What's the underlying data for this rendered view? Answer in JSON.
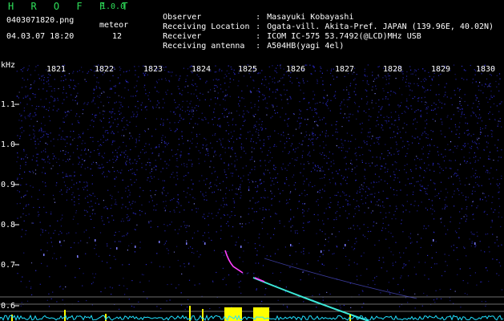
{
  "app": {
    "name": "H R O F F T",
    "version": "1.0.0",
    "filename": "0403071820.png",
    "count_label": "meteor",
    "datetime": "04.03.07 18:20",
    "count": "12"
  },
  "meta": [
    {
      "key": "Observer",
      "value": "Masayuki Kobayashi"
    },
    {
      "key": "Receiving Location",
      "value": "Ogata-vill. Akita-Pref. JAPAN (139.96E, 40.02N)"
    },
    {
      "key": "Receiver",
      "value": "ICOM IC-575 53.7492(@LCD)MHz USB"
    },
    {
      "key": "Receiving antenna",
      "value": "A504HB(yagi 4el)"
    }
  ],
  "axis": {
    "y_unit": "kHz",
    "y_ticks": [
      "1.1",
      "1.0",
      "0.9",
      "0.8",
      "0.7",
      "0.6"
    ],
    "x_ticks": [
      "1821",
      "1822",
      "1823",
      "1824",
      "1825",
      "1826",
      "1827",
      "1828",
      "1829",
      "1830"
    ]
  },
  "colors": {
    "background": "#000000",
    "noise": "#2828c8",
    "meteor_trail": "#3ce8d8",
    "head_echo": "#ff40ff",
    "burst": "#ffff00",
    "baseline": "#20e0ff",
    "title": "#2ee05a"
  }
}
